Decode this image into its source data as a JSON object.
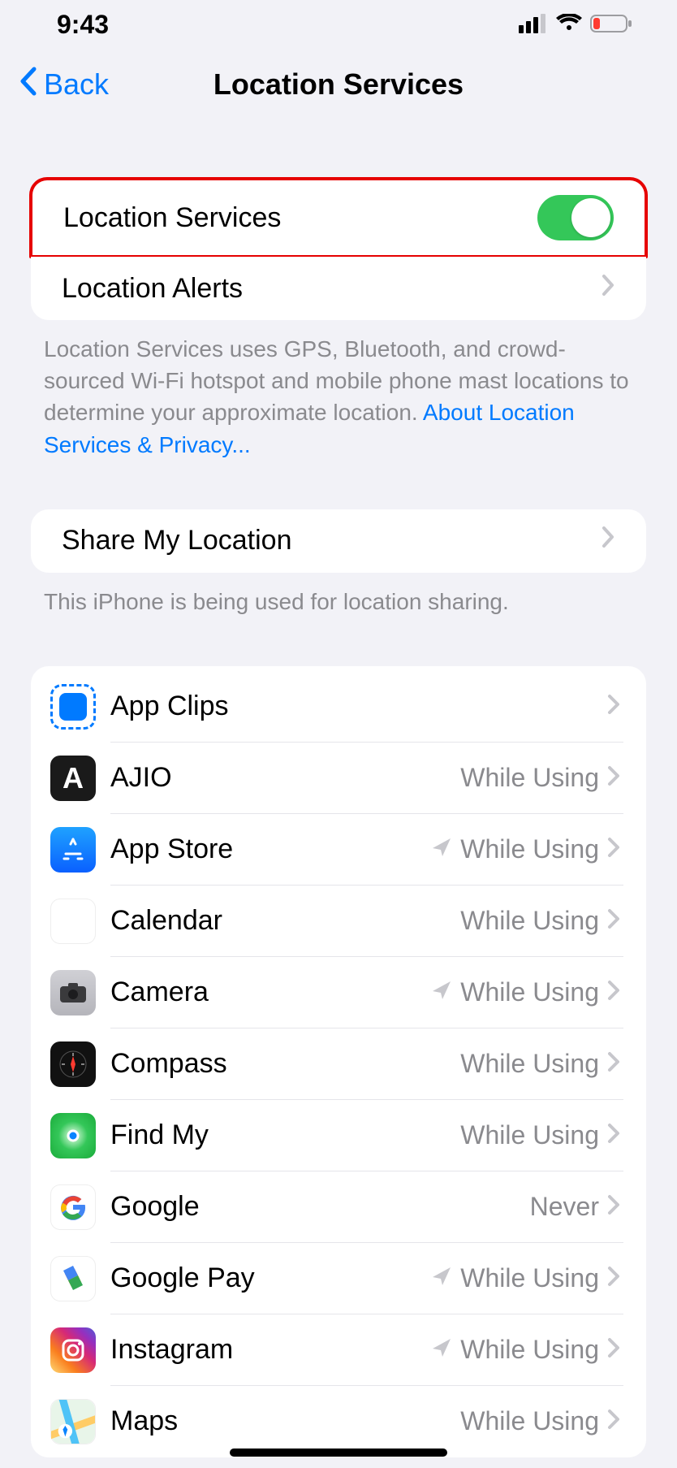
{
  "status": {
    "time": "9:43"
  },
  "nav": {
    "back": "Back",
    "title": "Location Services"
  },
  "group1": {
    "location_services": "Location Services",
    "location_alerts": "Location Alerts"
  },
  "footer1": {
    "text": "Location Services uses GPS, Bluetooth, and crowd-sourced Wi-Fi hotspot and mobile phone mast locations to determine your approximate location. ",
    "link": "About Location Services & Privacy..."
  },
  "group2": {
    "share": "Share My Location"
  },
  "footer2": {
    "text": "This iPhone is being used for location sharing."
  },
  "apps": [
    {
      "name": "App Clips",
      "status": "",
      "arrow": false
    },
    {
      "name": "AJIO",
      "status": "While Using",
      "arrow": false
    },
    {
      "name": "App Store",
      "status": "While Using",
      "arrow": true
    },
    {
      "name": "Calendar",
      "status": "While Using",
      "arrow": false
    },
    {
      "name": "Camera",
      "status": "While Using",
      "arrow": true
    },
    {
      "name": "Compass",
      "status": "While Using",
      "arrow": false
    },
    {
      "name": "Find My",
      "status": "While Using",
      "arrow": false
    },
    {
      "name": "Google",
      "status": "Never",
      "arrow": false
    },
    {
      "name": "Google Pay",
      "status": "While Using",
      "arrow": true
    },
    {
      "name": "Instagram",
      "status": "While Using",
      "arrow": true
    },
    {
      "name": "Maps",
      "status": "While Using",
      "arrow": false
    }
  ]
}
